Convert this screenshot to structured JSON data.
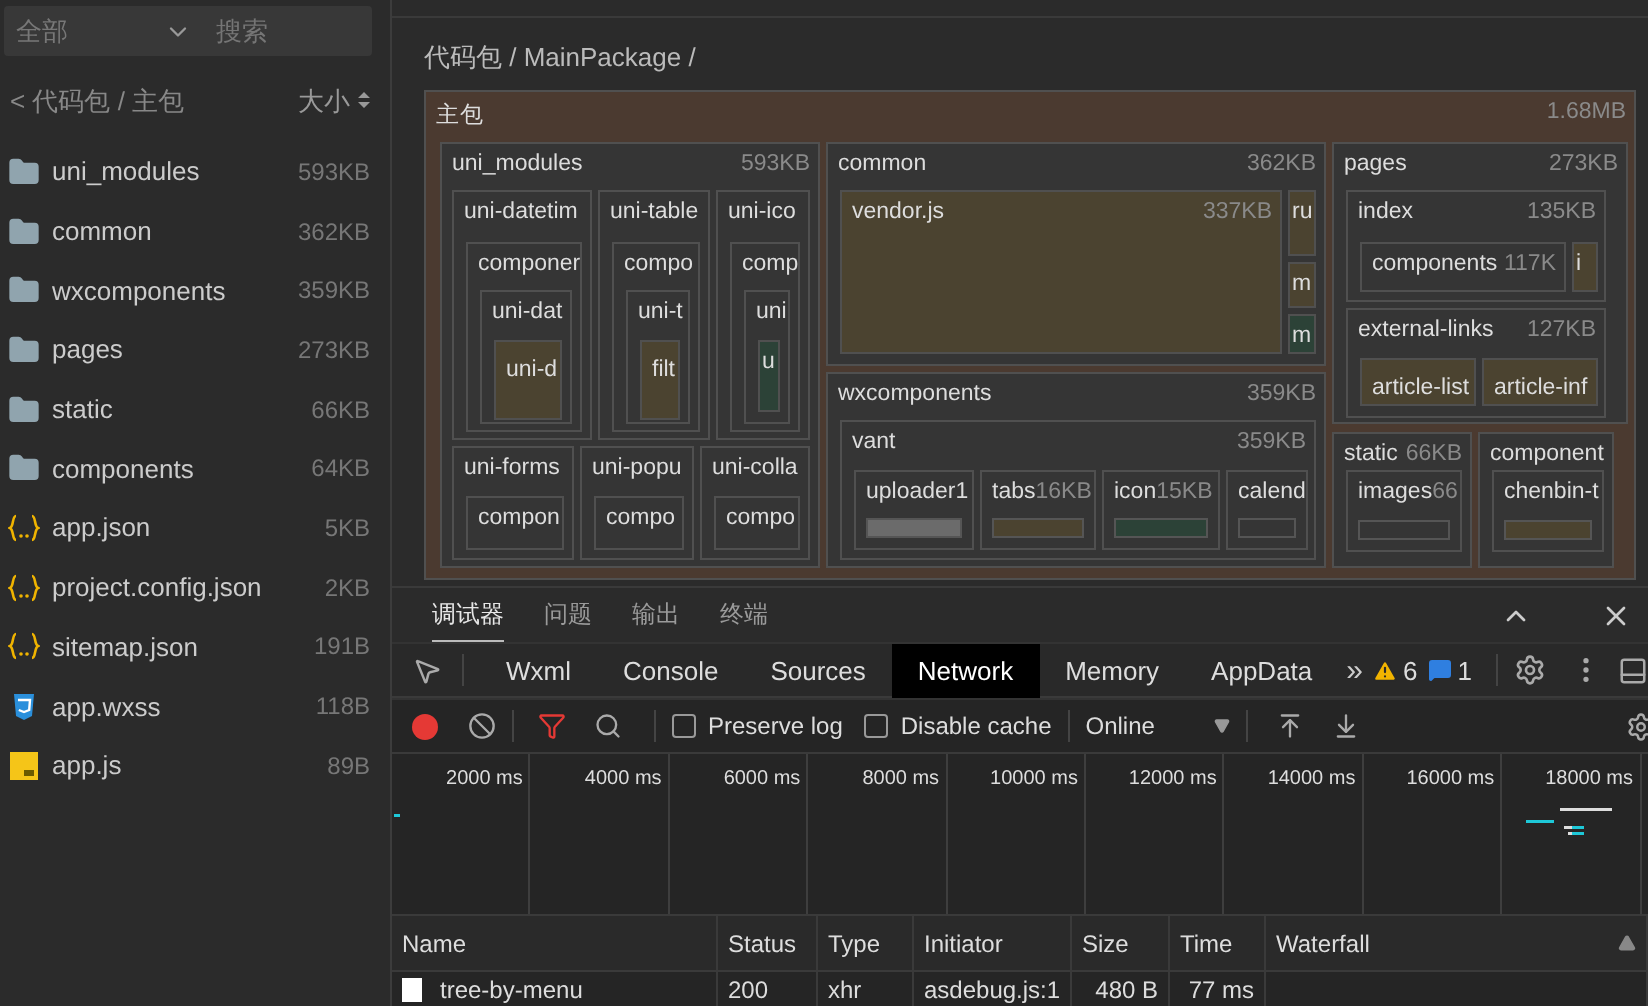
{
  "sidebar": {
    "filter": "全部",
    "search": {
      "placeholder": "搜索"
    },
    "breadcrumb": "< 代码包 / 主包",
    "sort_label": "大小",
    "items": [
      {
        "kind": "folder",
        "name": "uni_modules",
        "size": "593KB"
      },
      {
        "kind": "folder",
        "name": "common",
        "size": "362KB"
      },
      {
        "kind": "folder",
        "name": "wxcomponents",
        "size": "359KB"
      },
      {
        "kind": "folder",
        "name": "pages",
        "size": "273KB"
      },
      {
        "kind": "folder",
        "name": "static",
        "size": "66KB"
      },
      {
        "kind": "folder",
        "name": "components",
        "size": "64KB"
      },
      {
        "kind": "json",
        "name": "app.json",
        "size": "5KB"
      },
      {
        "kind": "json",
        "name": "project.config.json",
        "size": "2KB"
      },
      {
        "kind": "json",
        "name": "sitemap.json",
        "size": "191B"
      },
      {
        "kind": "css",
        "name": "app.wxss",
        "size": "118B"
      },
      {
        "kind": "js",
        "name": "app.js",
        "size": "89B"
      }
    ]
  },
  "path": "代码包 / MainPackage /",
  "treemap": {
    "kind": "group",
    "label": "主包",
    "size": "1.68MB",
    "children": [
      {
        "kind": "group",
        "label": "uni_modules",
        "size": "593KB",
        "children": [
          {
            "kind": "group",
            "label": "uni-datetim",
            "children": [
              {
                "kind": "group",
                "label": "componer",
                "children": [
                  {
                    "kind": "group",
                    "label": "uni-dat",
                    "children": [
                      {
                        "kind": "fill",
                        "label": "uni-d",
                        "color": "#4b4330"
                      }
                    ]
                  }
                ]
              }
            ]
          },
          {
            "kind": "group",
            "label": "uni-table",
            "children": [
              {
                "kind": "group",
                "label": "compo",
                "children": [
                  {
                    "kind": "group",
                    "label": "uni-t",
                    "children": [
                      {
                        "kind": "fill",
                        "label": "filt",
                        "color": "#4b4330"
                      }
                    ]
                  }
                ]
              }
            ]
          },
          {
            "kind": "group",
            "label": "uni-ico",
            "children": [
              {
                "kind": "group",
                "label": "comp",
                "children": [
                  {
                    "kind": "group",
                    "label": "uni",
                    "children": [
                      {
                        "kind": "fill",
                        "label": "u",
                        "color": "#2c4237"
                      }
                    ]
                  }
                ]
              }
            ]
          },
          {
            "kind": "group",
            "label": "uni-forms",
            "children": [
              {
                "kind": "group",
                "label": "compon"
              }
            ]
          },
          {
            "kind": "group",
            "label": "uni-popu",
            "children": [
              {
                "kind": "group",
                "label": "compo"
              }
            ]
          },
          {
            "kind": "group",
            "label": "uni-colla",
            "children": [
              {
                "kind": "group",
                "label": "compo"
              }
            ]
          }
        ]
      },
      {
        "kind": "group",
        "label": "common",
        "size": "362KB",
        "children": [
          {
            "kind": "fill",
            "label": "vendor.js",
            "size": "337KB",
            "color": "#4b4330"
          },
          {
            "kind": "fill",
            "label": "ru",
            "color": "#4b4330"
          },
          {
            "kind": "fill",
            "label": "m",
            "color": "#4b4330"
          },
          {
            "kind": "fill",
            "label": "m",
            "color": "#2c4237"
          }
        ]
      },
      {
        "kind": "group",
        "label": "wxcomponents",
        "size": "359KB",
        "children": [
          {
            "kind": "group",
            "label": "vant",
            "size": "359KB",
            "children": [
              {
                "kind": "bar",
                "label": "uploader1",
                "color": "#6b6b6b"
              },
              {
                "kind": "bar",
                "label": "tabs",
                "size": "16KB",
                "color": "#4b4330"
              },
              {
                "kind": "bar",
                "label": "icon",
                "size": "15KB",
                "color": "#2c4237"
              },
              {
                "kind": "bar",
                "label": "calend"
              }
            ]
          }
        ]
      },
      {
        "kind": "group",
        "label": "pages",
        "size": "273KB",
        "children": [
          {
            "kind": "group",
            "label": "index",
            "size": "135KB",
            "children": [
              {
                "kind": "group",
                "label": "components",
                "size": "117K"
              },
              {
                "kind": "fill",
                "label": "i",
                "color": "#4b4330"
              }
            ]
          },
          {
            "kind": "group",
            "label": "external-links",
            "size": "127KB",
            "children": [
              {
                "kind": "fill",
                "label": "article-list",
                "color": "#4b4330"
              },
              {
                "kind": "fill",
                "label": "article-inf",
                "color": "#4b4330"
              }
            ]
          }
        ]
      },
      {
        "kind": "group",
        "label": "static",
        "size": "66KB",
        "children": [
          {
            "kind": "bar",
            "label": "images",
            "size": "66"
          }
        ]
      },
      {
        "kind": "group",
        "label": "component",
        "children": [
          {
            "kind": "bar",
            "label": "chenbin-t",
            "color": "#4b4330"
          }
        ]
      }
    ]
  },
  "devtools": {
    "panel_tabs": [
      {
        "label": "调试器",
        "selected": true
      },
      {
        "label": "问题",
        "selected": false
      },
      {
        "label": "输出",
        "selected": false
      },
      {
        "label": "终端",
        "selected": false
      }
    ],
    "tool_tabs": [
      {
        "label": "Wxml",
        "selected": false
      },
      {
        "label": "Console",
        "selected": false
      },
      {
        "label": "Sources",
        "selected": false
      },
      {
        "label": "Network",
        "selected": true
      },
      {
        "label": "Memory",
        "selected": false
      },
      {
        "label": "AppData",
        "selected": false
      }
    ],
    "more": "»",
    "warnings": "6",
    "messages": "1",
    "preserve_log": {
      "label": "Preserve log",
      "checked": false
    },
    "disable_cache": {
      "label": "Disable cache",
      "checked": false
    },
    "throttle": "Online",
    "timeline_ticks": [
      "2000 ms",
      "4000 ms",
      "6000 ms",
      "8000 ms",
      "10000 ms",
      "12000 ms",
      "14000 ms",
      "16000 ms",
      "18000 ms"
    ],
    "columns": [
      "Name",
      "Status",
      "Type",
      "Initiator",
      "Size",
      "Time",
      "Waterfall"
    ],
    "rows": [
      [
        "tree-by-menu",
        "200",
        "xhr",
        "asdebug.js:1",
        "480 B",
        "77 ms"
      ]
    ]
  }
}
